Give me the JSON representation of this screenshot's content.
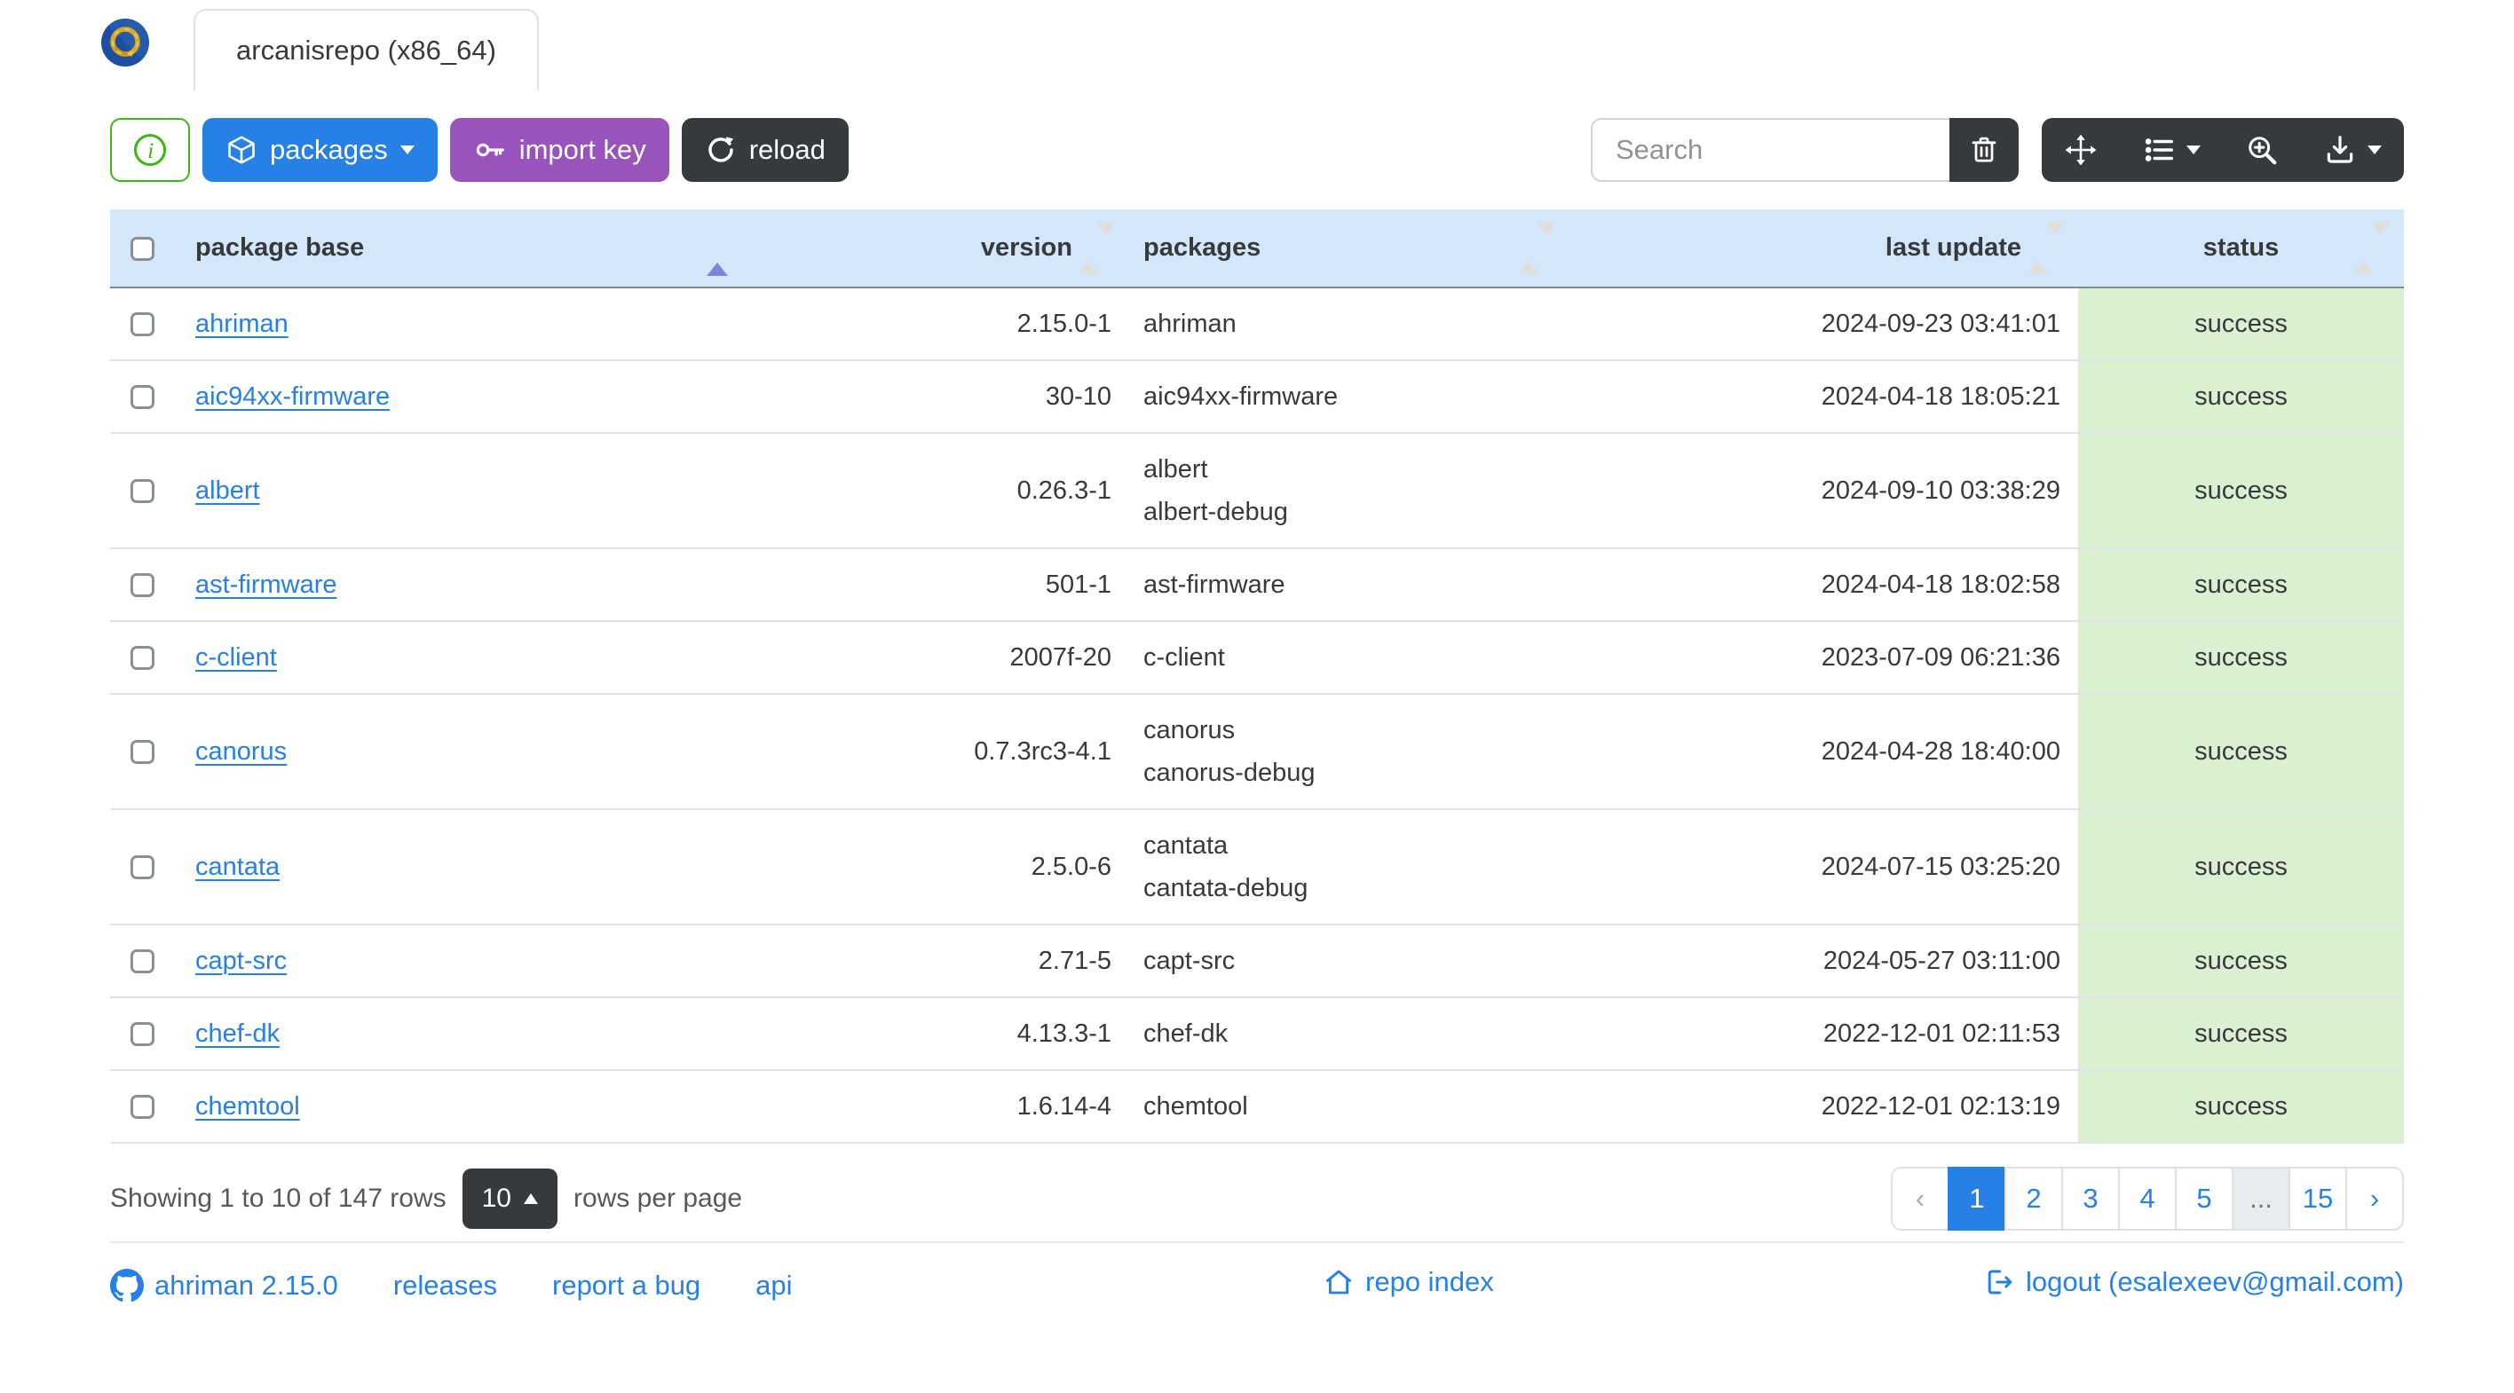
{
  "window": {
    "tab_label": "arcanisrepo (x86_64)"
  },
  "toolbar": {
    "packages_label": "packages",
    "import_key_label": "import key",
    "reload_label": "reload",
    "search_placeholder": "Search"
  },
  "icons": {
    "logo": "ahriman-dragon-emblem",
    "info": "info-circle",
    "packages": "cube",
    "import_key": "key",
    "reload": "rotate-arrow",
    "clear": "trash",
    "fullscreen": "arrows-move",
    "columns": "list",
    "advanced_search": "magnifier-plus",
    "export": "download-tray",
    "github": "github-mark",
    "repo_index": "house",
    "logout": "box-arrow-right"
  },
  "table": {
    "headers": [
      "package base",
      "version",
      "packages",
      "last update",
      "status"
    ],
    "sort": {
      "column": "package base",
      "direction": "asc"
    },
    "rows": [
      {
        "base": "ahriman",
        "version": "2.15.0-1",
        "packages": [
          "ahriman"
        ],
        "last_update": "2024-09-23 03:41:01",
        "status": "success"
      },
      {
        "base": "aic94xx-firmware",
        "version": "30-10",
        "packages": [
          "aic94xx-firmware"
        ],
        "last_update": "2024-04-18 18:05:21",
        "status": "success"
      },
      {
        "base": "albert",
        "version": "0.26.3-1",
        "packages": [
          "albert",
          "albert-debug"
        ],
        "last_update": "2024-09-10 03:38:29",
        "status": "success"
      },
      {
        "base": "ast-firmware",
        "version": "501-1",
        "packages": [
          "ast-firmware"
        ],
        "last_update": "2024-04-18 18:02:58",
        "status": "success"
      },
      {
        "base": "c-client",
        "version": "2007f-20",
        "packages": [
          "c-client"
        ],
        "last_update": "2023-07-09 06:21:36",
        "status": "success"
      },
      {
        "base": "canorus",
        "version": "0.7.3rc3-4.1",
        "packages": [
          "canorus",
          "canorus-debug"
        ],
        "last_update": "2024-04-28 18:40:00",
        "status": "success"
      },
      {
        "base": "cantata",
        "version": "2.5.0-6",
        "packages": [
          "cantata",
          "cantata-debug"
        ],
        "last_update": "2024-07-15 03:25:20",
        "status": "success"
      },
      {
        "base": "capt-src",
        "version": "2.71-5",
        "packages": [
          "capt-src"
        ],
        "last_update": "2024-05-27 03:11:00",
        "status": "success"
      },
      {
        "base": "chef-dk",
        "version": "4.13.3-1",
        "packages": [
          "chef-dk"
        ],
        "last_update": "2022-12-01 02:11:53",
        "status": "success"
      },
      {
        "base": "chemtool",
        "version": "1.6.14-4",
        "packages": [
          "chemtool"
        ],
        "last_update": "2022-12-01 02:13:19",
        "status": "success"
      }
    ]
  },
  "pagination": {
    "info": "Showing 1 to 10 of 147 rows",
    "page_size": "10",
    "rows_per_page_label": "rows per page",
    "prev": "‹",
    "next": "›",
    "pages": [
      "1",
      "2",
      "3",
      "4",
      "5",
      "...",
      "15"
    ],
    "active_page": "1"
  },
  "footer": {
    "version_link": "ahriman 2.15.0",
    "releases_link": "releases",
    "report_bug_link": "report a bug",
    "api_link": "api",
    "repo_index_link": "repo index",
    "logout_link": "logout (esalexeev@gmail.com)"
  },
  "colors": {
    "primary": "#2780e3",
    "info_purple": "#9954bb",
    "success_green": "#3fb618",
    "dark": "#373a3c",
    "header_bg": "#d4e6f9",
    "status_bg": "#d9f0d1"
  }
}
